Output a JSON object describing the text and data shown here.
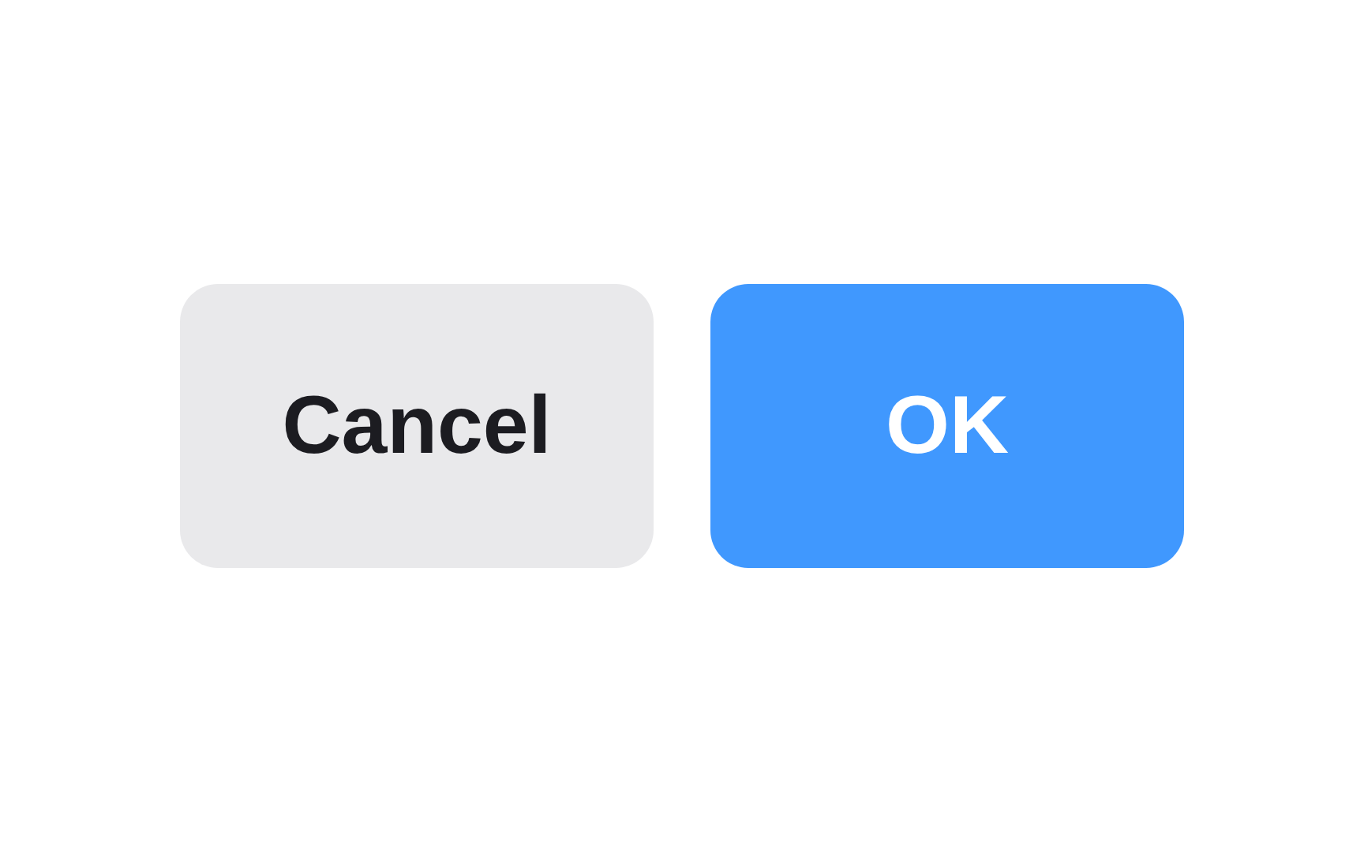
{
  "buttons": [
    {
      "label": "Cancel",
      "kind": "secondary"
    },
    {
      "label": "OK",
      "kind": "primary"
    }
  ]
}
